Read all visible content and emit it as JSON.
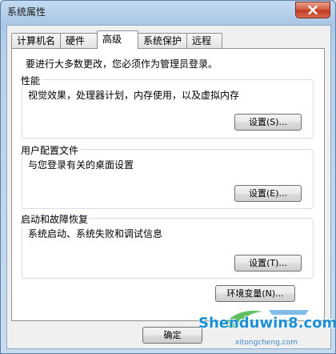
{
  "window": {
    "title": "系统属性"
  },
  "tabs": [
    {
      "label": "计算机名"
    },
    {
      "label": "硬件"
    },
    {
      "label": "高级"
    },
    {
      "label": "系统保护"
    },
    {
      "label": "远程"
    }
  ],
  "active_tab": "高级",
  "notice": "要进行大多数更改，您必须作为管理员登录。",
  "groups": {
    "performance": {
      "title": "性能",
      "desc": "视觉效果，处理器计划，内存使用，以及虚拟内存",
      "button": "设置(S)..."
    },
    "user_profiles": {
      "title": "用户配置文件",
      "desc": "与您登录有关的桌面设置",
      "button": "设置(E)..."
    },
    "startup": {
      "title": "启动和故障恢复",
      "desc": "系统启动、系统失败和调试信息",
      "button": "设置(T)..."
    }
  },
  "env_button": "环境变量(N)...",
  "ok_button": "确定",
  "watermark": {
    "text": "Shenduwin8.com",
    "sub": "xitongcheng.com"
  },
  "icons": {
    "close": "close-icon",
    "watermark_logo": "watermark-logo-icon"
  },
  "colors": {
    "close_red": "#c0391f",
    "titlebar_blue": "#a9c6e6",
    "watermark_blue": "#1b8fd6"
  }
}
